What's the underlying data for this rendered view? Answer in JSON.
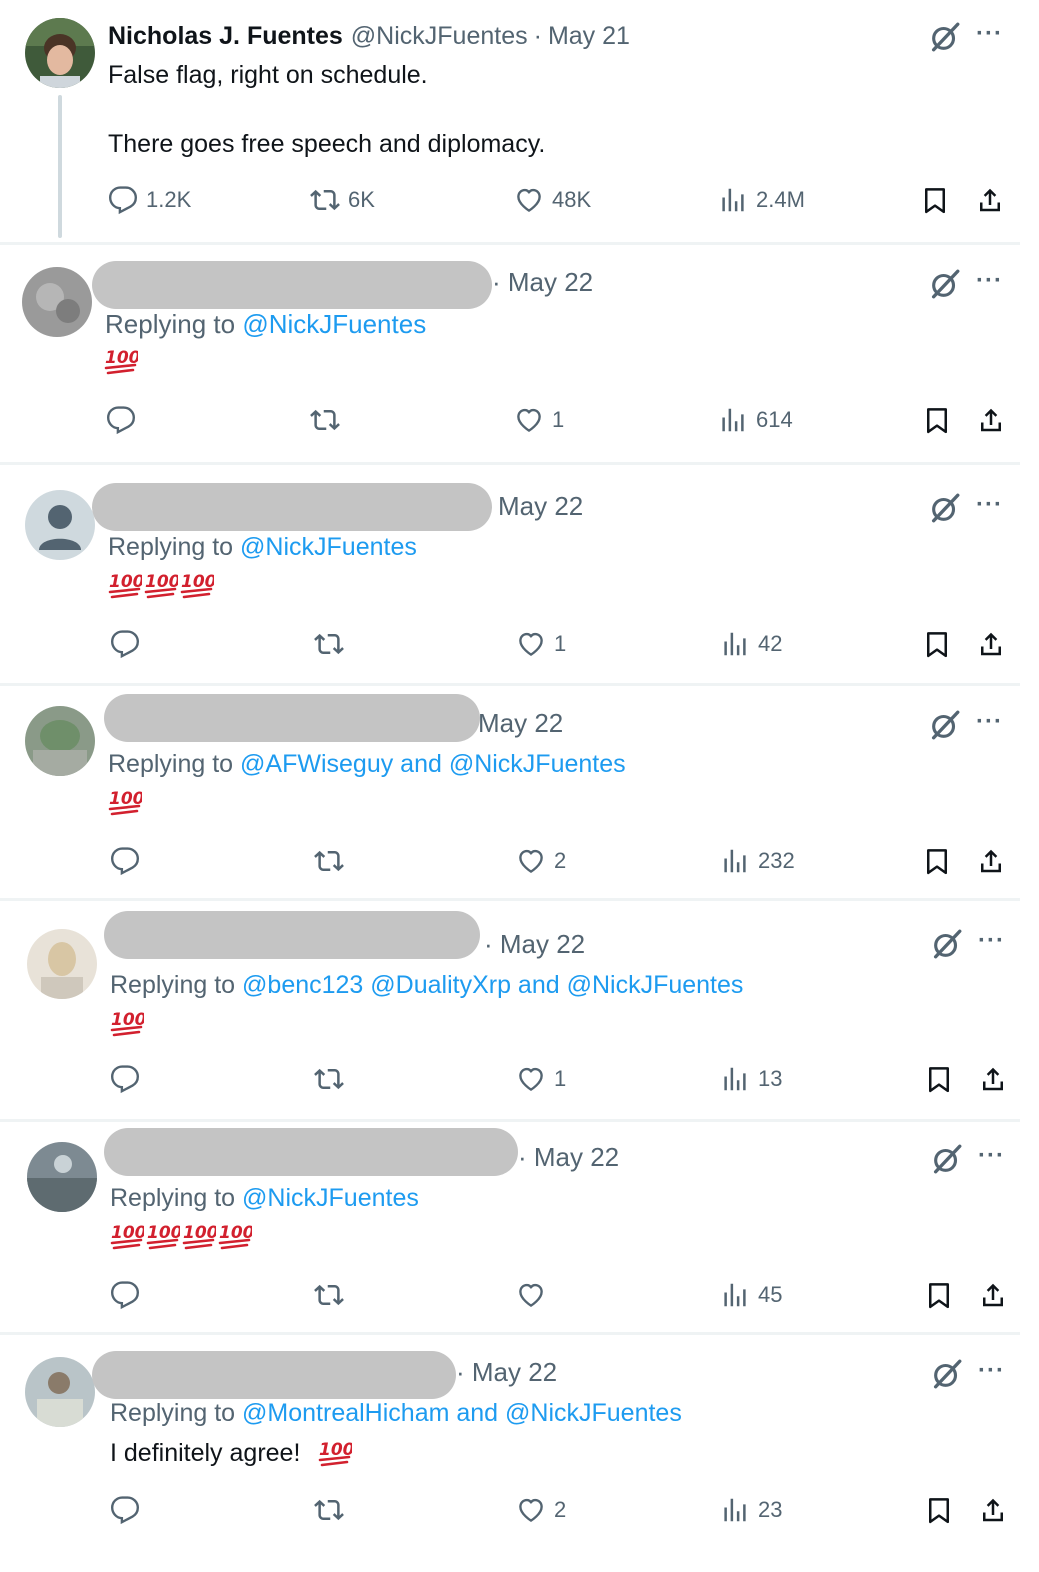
{
  "main_tweet": {
    "name": "Nicholas J. Fuentes",
    "handle": "@NickJFuentes",
    "separator": "·",
    "date": "May 21",
    "text_line1": "False flag, right on schedule.",
    "text_line2": "There goes free speech and diplomacy.",
    "replies": "1.2K",
    "reposts": "6K",
    "likes": "48K",
    "views": "2.4M"
  },
  "replies": [
    {
      "date": "· May 22",
      "replying_label": "Replying to",
      "mentions": "@NickJFuentes",
      "text": "",
      "hundred_count": 1,
      "replies": "",
      "reposts": "",
      "likes": "1",
      "views": "614"
    },
    {
      "date": "May 22",
      "replying_label": "Replying to",
      "mentions": "@NickJFuentes",
      "text": "",
      "hundred_count": 3,
      "replies": "",
      "reposts": "",
      "likes": "1",
      "views": "42"
    },
    {
      "date": "May 22",
      "replying_label": "Replying to",
      "mentions": "@AFWiseguy and @NickJFuentes",
      "text": "",
      "hundred_count": 1,
      "replies": "",
      "reposts": "",
      "likes": "2",
      "views": "232"
    },
    {
      "date": "· May 22",
      "replying_label": "Replying to",
      "mentions": "@benc123 @DualityXrp and @NickJFuentes",
      "text": "",
      "hundred_count": 1,
      "replies": "",
      "reposts": "",
      "likes": "1",
      "views": "13"
    },
    {
      "date": "· May 22",
      "replying_label": "Replying to",
      "mentions": "@NickJFuentes",
      "text": "",
      "hundred_count": 4,
      "replies": "",
      "reposts": "",
      "likes": "",
      "views": "45"
    },
    {
      "date": "· May 22",
      "replying_label": "Replying to",
      "mentions": "@MontrealHicham and @NickJFuentes",
      "text": "I definitely agree!",
      "hundred_count": 1,
      "replies": "",
      "reposts": "",
      "likes": "2",
      "views": "23"
    }
  ],
  "icons": {
    "reply": "reply-bubble-icon",
    "repost": "repost-icon",
    "like": "heart-icon",
    "views": "views-chart-icon",
    "bookmark": "bookmark-icon",
    "share": "share-upload-icon",
    "grok": "grok-icon",
    "more": "more-dots-icon",
    "hundred": "hundred-points-emoji"
  },
  "colors": {
    "text": "#0f1419",
    "secondary": "#536471",
    "link": "#1d9bf0",
    "hundred_red": "#d2202e",
    "redaction": "#c4c4c4",
    "divider": "#eff3f4"
  }
}
